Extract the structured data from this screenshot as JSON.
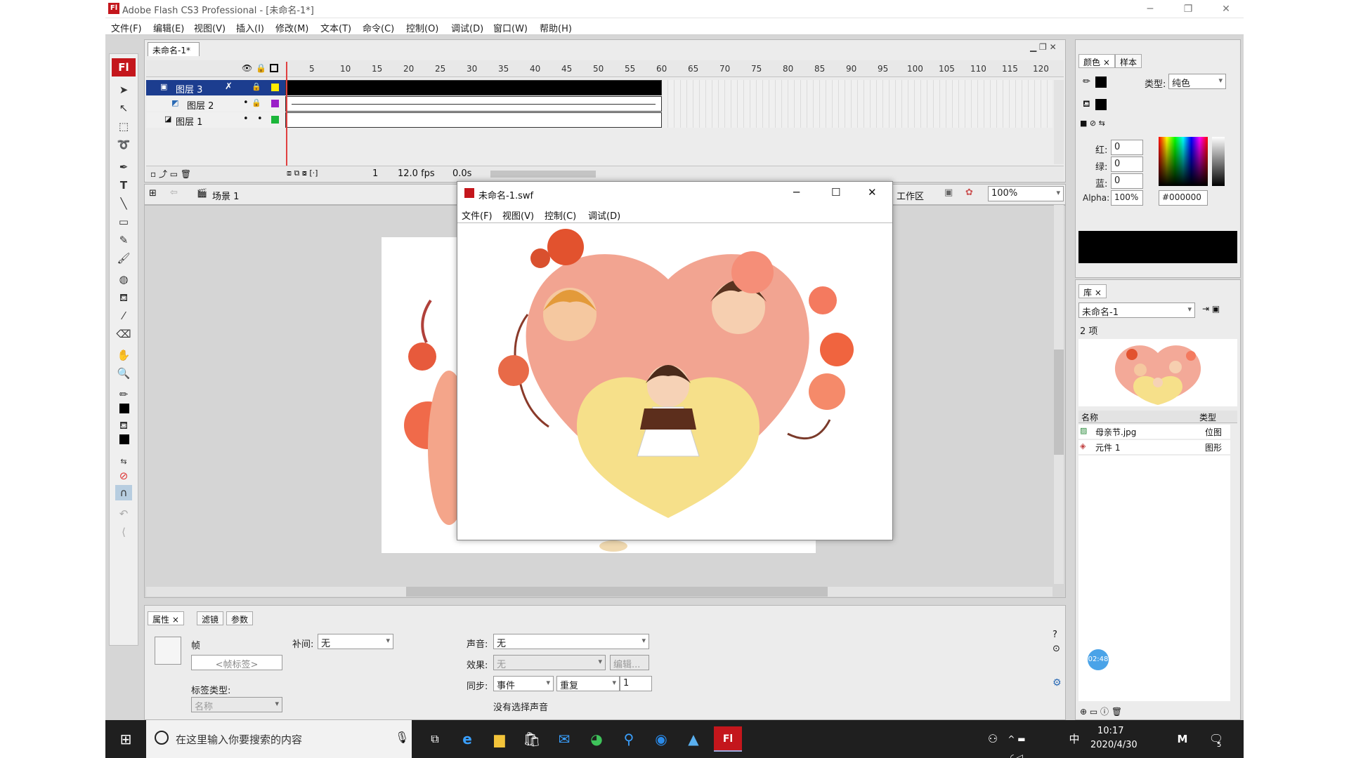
{
  "window": {
    "title": "Adobe Flash CS3 Professional - [未命名-1*]",
    "app_badge": "Fl",
    "minimize": "─",
    "restore": "❐",
    "close": "✕"
  },
  "menu": [
    "文件(F)",
    "编辑(E)",
    "视图(V)",
    "插入(I)",
    "修改(M)",
    "文本(T)",
    "命令(C)",
    "控制(O)",
    "调试(D)",
    "窗口(W)",
    "帮助(H)"
  ],
  "tools": {
    "logo": "Fl"
  },
  "timeline": {
    "doc_tab": "未命名-1*",
    "frame_numbers": [
      "5",
      "10",
      "15",
      "20",
      "25",
      "30",
      "35",
      "40",
      "45",
      "50",
      "55",
      "60",
      "65",
      "70",
      "75",
      "80",
      "85",
      "90",
      "95",
      "100",
      "105",
      "110",
      "115",
      "120"
    ],
    "layers": [
      {
        "name": "图层 3",
        "selected": true
      },
      {
        "name": "图层 2",
        "selected": false
      },
      {
        "name": "图层 1",
        "selected": false
      }
    ],
    "current_frame": "1",
    "fps": "12.0 fps",
    "time": "0.0s"
  },
  "scene": {
    "label": "场景 1",
    "workspace": "工作区",
    "zoom": "100%"
  },
  "swf": {
    "title": "未命名-1.swf",
    "menu": [
      "文件(F)",
      "视图(V)",
      "控制(C)",
      "调试(D)"
    ]
  },
  "props": {
    "tabs": [
      "属性",
      "滤镜",
      "参数"
    ],
    "frame_label": "帧",
    "frame_name_placeholder": "<帧标签>",
    "label_type_label": "标签类型:",
    "label_type_value": "名称",
    "tween_label": "补间:",
    "tween_value": "无",
    "sound_label": "声音:",
    "sound_value": "无",
    "effect_label": "效果:",
    "effect_value": "无",
    "edit_button": "编辑...",
    "sync_label": "同步:",
    "sync_value": "事件",
    "repeat_value": "重复",
    "repeat_count": "1",
    "no_sound": "没有选择声音"
  },
  "color": {
    "tabs": [
      "颜色",
      "样本"
    ],
    "type_label": "类型:",
    "type_value": "纯色",
    "r_label": "红:",
    "g_label": "绿:",
    "b_label": "蓝:",
    "r": "0",
    "g": "0",
    "b": "0",
    "alpha_label": "Alpha:",
    "alpha": "100%",
    "hex": "#000000"
  },
  "library": {
    "tab": "库",
    "doc": "未命名-1",
    "count": "2 项",
    "col_name": "名称",
    "col_type": "类型",
    "items": [
      {
        "name": "母亲节.jpg",
        "type": "位图"
      },
      {
        "name": "元件 1",
        "type": "图形"
      }
    ]
  },
  "badge": "02:48",
  "taskbar": {
    "search_placeholder": "在这里输入你要搜索的内容",
    "time": "10:17",
    "date": "2020/4/30",
    "ime": "中",
    "notify_count": "5"
  }
}
